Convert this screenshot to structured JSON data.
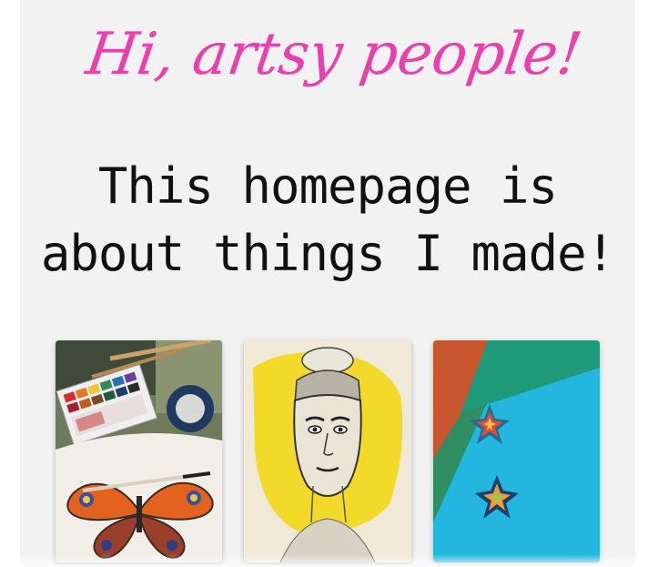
{
  "hero": {
    "greeting": "Hi, artsy people!",
    "intro_line_1": "This homepage is",
    "intro_line_2": "about things I made!"
  },
  "gallery": {
    "items": [
      {
        "icon": "watercolor-butterfly-painting-image"
      },
      {
        "icon": "pencil-portrait-drawing-image"
      },
      {
        "icon": "origami-stars-image"
      }
    ]
  },
  "colors": {
    "accent": "#ec3fae",
    "panel_bg": "#f2f2f2",
    "text": "#111111"
  }
}
